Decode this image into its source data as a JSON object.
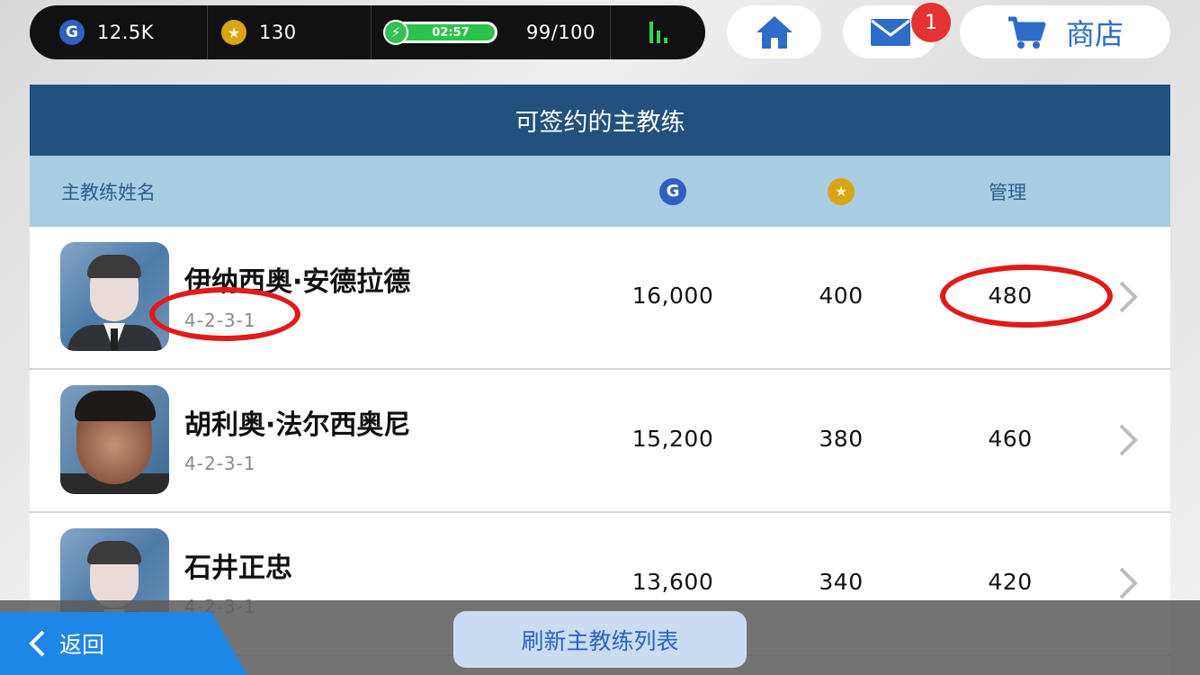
{
  "status": {
    "gp_value": "12.5K",
    "coins_value": "130",
    "energy_timer": "02:57",
    "energy_value": "99/100",
    "energy_fraction": 0.99
  },
  "nav": {
    "mail_badge": "1",
    "shop_label": "商店"
  },
  "panel": {
    "title": "可签约的主教练",
    "headers": {
      "name": "主教练姓名",
      "management": "管理"
    },
    "coaches": [
      {
        "name": "伊纳西奥·安德拉德",
        "formation": "4-2-3-1",
        "gp": "16,000",
        "coins": "400",
        "management": "480"
      },
      {
        "name": "胡利奥·法尔西奥尼",
        "formation": "4-2-3-1",
        "gp": "15,200",
        "coins": "380",
        "management": "460"
      },
      {
        "name": "石井正忠",
        "formation": "4-2-3-1",
        "gp": "13,600",
        "coins": "340",
        "management": "420"
      }
    ]
  },
  "footer": {
    "back_label": "返回",
    "refresh_label": "刷新主教练列表"
  },
  "colors": {
    "title_bar": "#22507f",
    "header_row": "#a8cde2",
    "back_button": "#1e86e6",
    "highlight_ellipse": "#e11a1a"
  }
}
